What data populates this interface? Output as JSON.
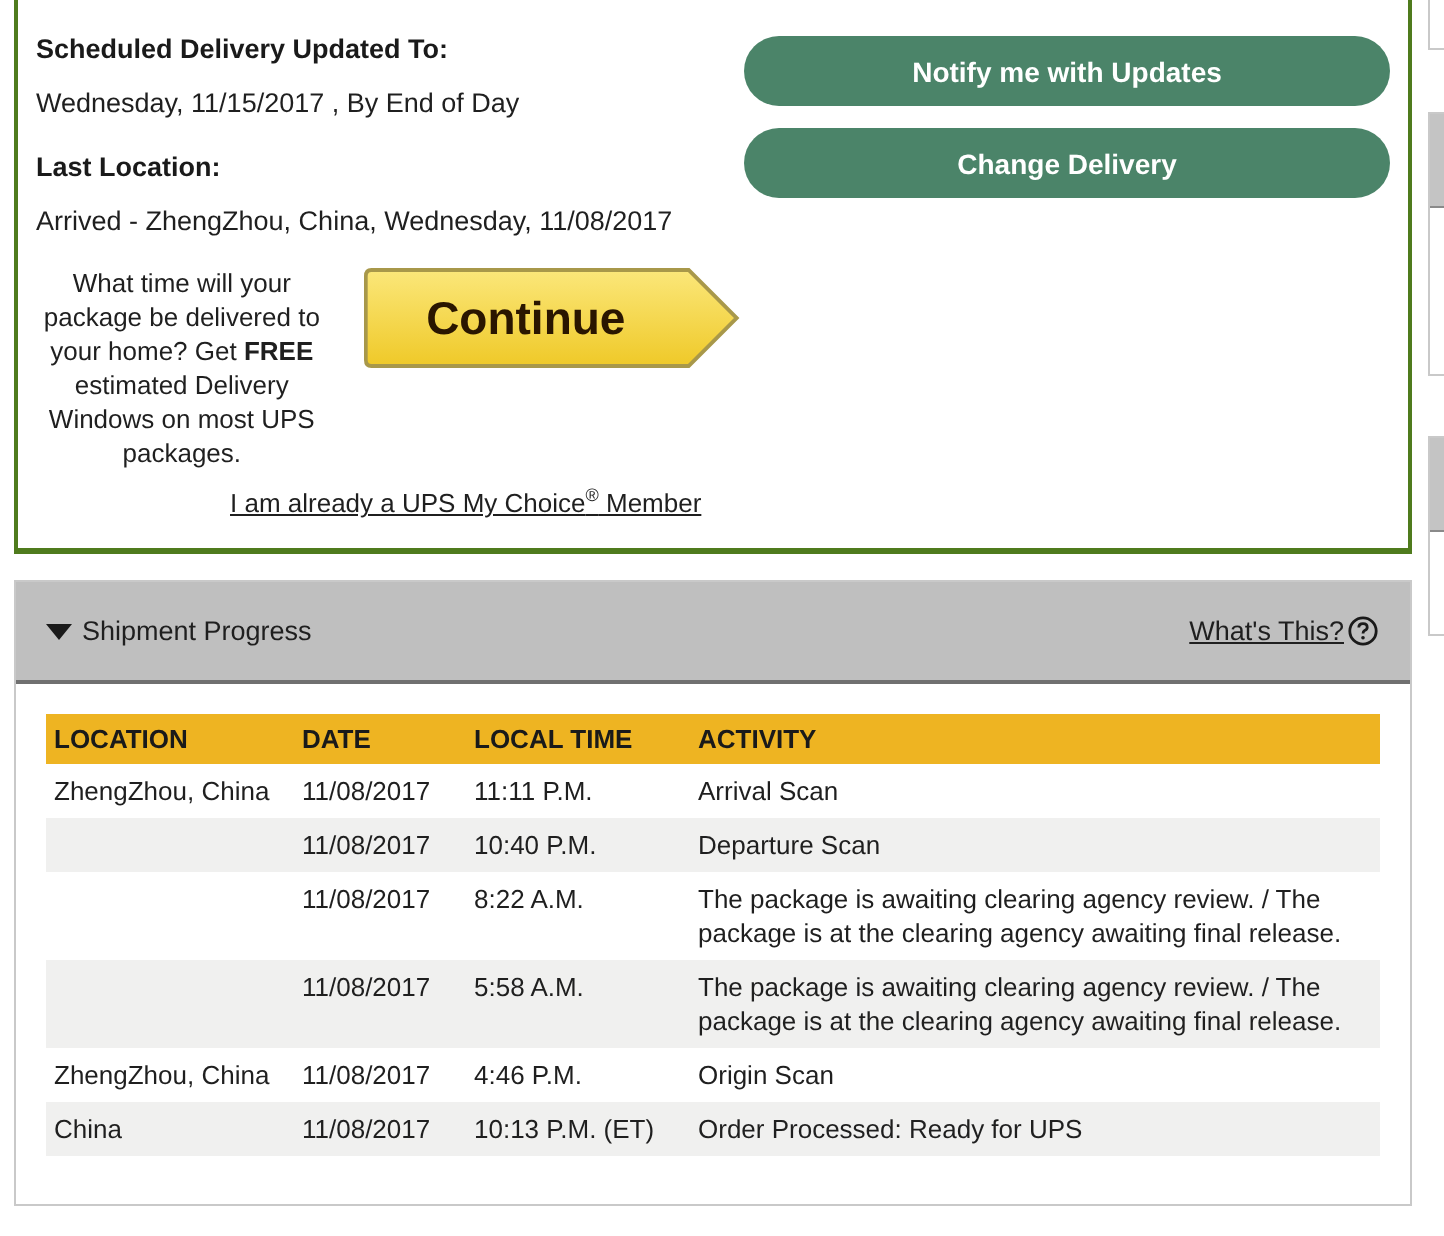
{
  "scheduled_delivery": {
    "heading": "Scheduled Delivery Updated To:",
    "value": "Wednesday, 11/15/2017 , By End of Day"
  },
  "last_location": {
    "heading": "Last Location:",
    "value": "Arrived - ZhengZhou, China, Wednesday, 11/08/2017"
  },
  "promo": {
    "text": "What time will your package be delivered to your home? Get **FREE** estimated Delivery Windows on most UPS packages.",
    "button": "Continue",
    "link": "I am already a UPS My Choice$^{®}$ Member"
  },
  "actions": [
    "Notify me with Updates",
    "Change Delivery"
  ],
  "shipment_progress": {
    "title": "Shipment Progress",
    "expanded": true,
    "help_link": "What's This?",
    "table": {
      "columns": [
        "LOCATION",
        "DATE",
        "LOCAL TIME",
        "ACTIVITY"
      ],
      "rows": [
        {
          "location": "ZhengZhou, China",
          "date": "11/08/2017",
          "local_time": "11:11 P.M.",
          "activity": "Arrival Scan"
        },
        {
          "date": "11/08/2017",
          "local_time": "10:40 P.M.",
          "activity": "Departure Scan"
        },
        {
          "date": "11/08/2017",
          "local_time": "8:22 A.M.",
          "activity": "The package is awaiting clearing agency review. / The package is at the clearing agency awaiting final release."
        },
        {
          "date": "11/08/2017",
          "local_time": "5:58 A.M.",
          "activity": "The package is awaiting clearing agency review. / The package is at the clearing agency awaiting final release."
        },
        {
          "location": "ZhengZhou, China",
          "date": "11/08/2017",
          "local_time": "4:46 P.M.",
          "activity": "Origin Scan"
        },
        {
          "location": "China",
          "date": "11/08/2017",
          "local_time": "10:13 P.M. (ET)",
          "activity": "Order Processed: Ready for UPS"
        }
      ]
    }
  }
}
